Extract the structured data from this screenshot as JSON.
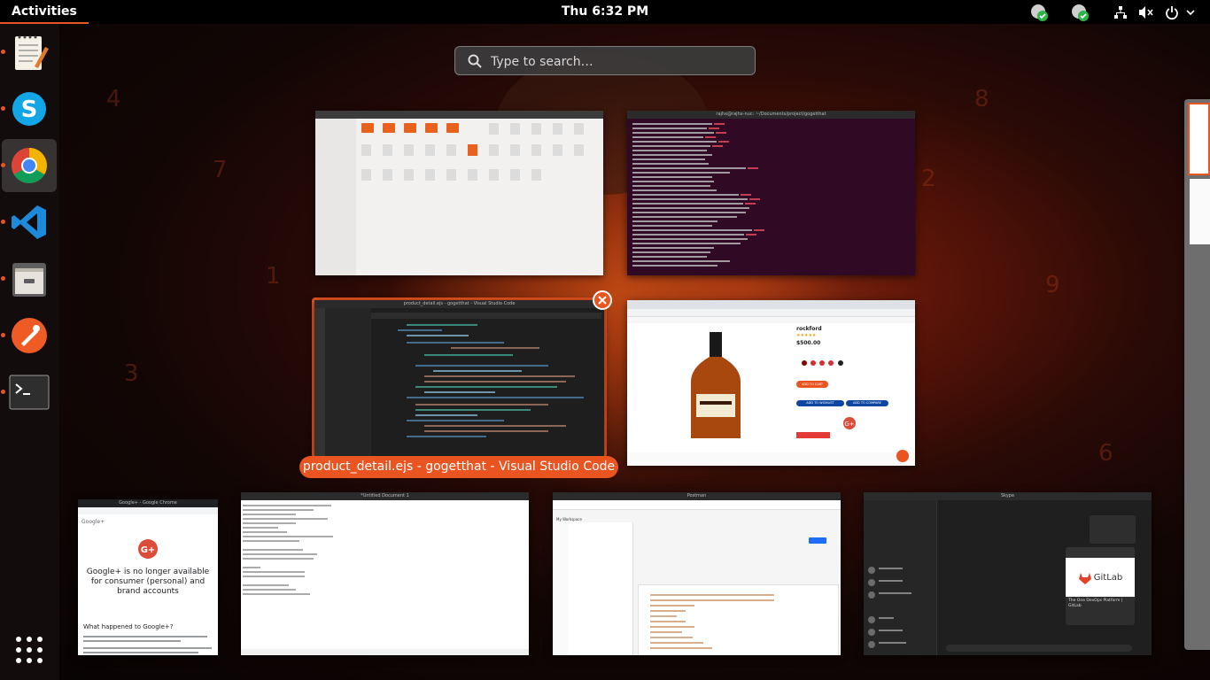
{
  "topbar": {
    "activities_label": "Activities",
    "clock": "Thu  6:32 PM"
  },
  "tray_icons": [
    "sync-ok-icon",
    "sync-ok-icon",
    "network-icon",
    "volume-muted-icon",
    "power-icon",
    "chevron-down-icon"
  ],
  "dock": {
    "items": [
      {
        "name": "text-editor",
        "icon": "text-editor-icon",
        "running": true
      },
      {
        "name": "skype",
        "icon": "skype-icon",
        "running": true
      },
      {
        "name": "chrome",
        "icon": "chrome-icon",
        "running": true,
        "active": true
      },
      {
        "name": "vscode",
        "icon": "vscode-icon",
        "running": true
      },
      {
        "name": "files",
        "icon": "file-cabinet-icon",
        "running": true
      },
      {
        "name": "postman",
        "icon": "postman-icon",
        "running": true
      },
      {
        "name": "terminal",
        "icon": "terminal-icon",
        "running": true
      }
    ],
    "show_apps_icon": "grid-icon"
  },
  "search": {
    "placeholder": "Type to search…"
  },
  "selected_window_caption": "product_detail.ejs - gogetthat - Visual Studio Code",
  "windows": {
    "terminal": {
      "title": "rajhx@rajhx-nuc: ~/Documents/project/gogetthat"
    },
    "vscode": {
      "title": "product_detail.ejs - gogetthat - Visual Studio Code"
    },
    "chrome_product": {
      "product_name": "rockford",
      "price": "$500.00",
      "add_to_cart": "ADD TO CART",
      "add_to_wishlist": "ADD TO WISHLIST",
      "add_to_compare": "ADD TO COMPARE"
    },
    "chrome_google": {
      "title": "Google+ - Google Chrome",
      "heading": "Google+ is no longer available for consumer (personal) and brand accounts",
      "subheading": "What happened to Google+?"
    },
    "gedit": {
      "title": "*Untitled Document 1"
    },
    "postman": {
      "title": "Postman",
      "workspace": "My Workspace"
    },
    "skype": {
      "title": "Skype",
      "card_title": "GitLab",
      "card_sub": "The One DevOps Platform | GitLab"
    }
  },
  "colors": {
    "accent": "#e95420",
    "topbar": "#000000",
    "terminal_bg": "#300a24"
  }
}
